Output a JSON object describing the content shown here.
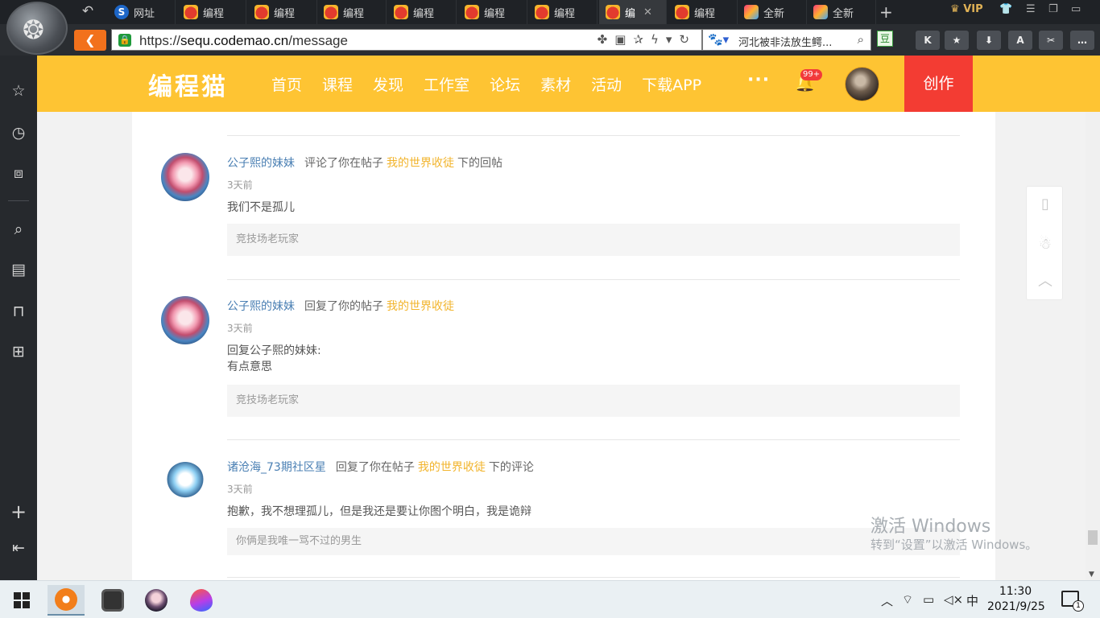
{
  "browser": {
    "tabs": [
      {
        "label": "网址",
        "icon": "sogou-icon"
      },
      {
        "label": "编程",
        "icon": "codemao-icon"
      },
      {
        "label": "编程",
        "icon": "codemao-icon"
      },
      {
        "label": "编程",
        "icon": "codemao-icon"
      },
      {
        "label": "编程",
        "icon": "codemao-icon"
      },
      {
        "label": "编程",
        "icon": "codemao-icon"
      },
      {
        "label": "编程",
        "icon": "codemao-icon"
      },
      {
        "label": "编",
        "icon": "codemao-icon",
        "active": true
      },
      {
        "label": "编程",
        "icon": "codemao-icon"
      },
      {
        "label": "全新",
        "icon": "app-icon"
      },
      {
        "label": "全新",
        "icon": "app-icon"
      }
    ],
    "vip_label": "VIP",
    "url_prefix": "https://",
    "url_host": "sequ.codemao.cn",
    "url_path": "/message",
    "search_text": "河北被非法放生鳄...",
    "dou_label": "豆",
    "toolbar_buttons": [
      "K",
      "★",
      "⬇",
      "A",
      "✂",
      "…"
    ]
  },
  "site": {
    "brand": "编程猫",
    "nav": [
      "首页",
      "课程",
      "发现",
      "工作室",
      "论坛",
      "素材",
      "活动",
      "下载APP"
    ],
    "more": "···",
    "badge": "99+",
    "create_label": "创作",
    "accent_color": "#fec433",
    "create_color": "#f33c33"
  },
  "messages": [
    {
      "user": "公子熙的妹妹",
      "action": "评论了你在帖子",
      "post": "我的世界收徒",
      "suffix": "下的回帖",
      "time": "3天前",
      "body": [
        "我们不是孤儿"
      ],
      "quote": "竞技场老玩家",
      "avatar": "anime-girl-avatar"
    },
    {
      "user": "公子熙的妹妹",
      "action": "回复了你的帖子",
      "post": "我的世界收徒",
      "suffix": "",
      "time": "3天前",
      "body": [
        "回复公子熙的妹妹:",
        "有点意思"
      ],
      "quote": "竞技场老玩家",
      "avatar": "anime-girl-avatar"
    },
    {
      "user": "诸沧海_73期社区星",
      "action": "回复了你在帖子",
      "post": "我的世界收徒",
      "suffix": "下的评论",
      "time": "3天前",
      "body": [
        "抱歉，我不想理孤儿，但是我还是要让你图个明白，我是诡辩"
      ],
      "quote": "你俩是我唯一骂不过的男生",
      "avatar": "blue-mascot-avatar"
    }
  ],
  "watermark": {
    "line1": "激活 Windows",
    "line2": "转到“设置”以激活 Windows。"
  },
  "taskbar": {
    "ime": "中",
    "time": "11:30",
    "date": "2021/9/25",
    "notifications": "1"
  }
}
